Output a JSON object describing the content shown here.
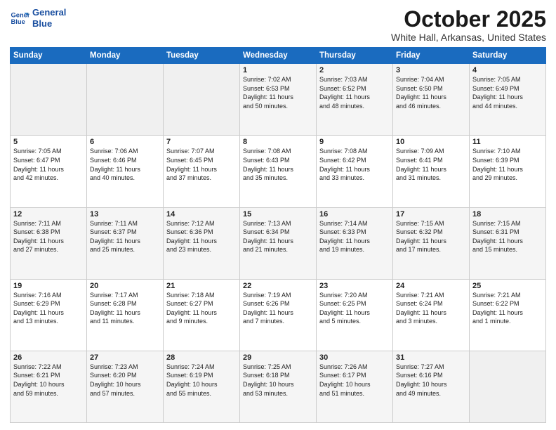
{
  "header": {
    "logo_line1": "General",
    "logo_line2": "Blue",
    "month": "October 2025",
    "location": "White Hall, Arkansas, United States"
  },
  "days_of_week": [
    "Sunday",
    "Monday",
    "Tuesday",
    "Wednesday",
    "Thursday",
    "Friday",
    "Saturday"
  ],
  "weeks": [
    [
      {
        "day": "",
        "info": ""
      },
      {
        "day": "",
        "info": ""
      },
      {
        "day": "",
        "info": ""
      },
      {
        "day": "1",
        "info": "Sunrise: 7:02 AM\nSunset: 6:53 PM\nDaylight: 11 hours\nand 50 minutes."
      },
      {
        "day": "2",
        "info": "Sunrise: 7:03 AM\nSunset: 6:52 PM\nDaylight: 11 hours\nand 48 minutes."
      },
      {
        "day": "3",
        "info": "Sunrise: 7:04 AM\nSunset: 6:50 PM\nDaylight: 11 hours\nand 46 minutes."
      },
      {
        "day": "4",
        "info": "Sunrise: 7:05 AM\nSunset: 6:49 PM\nDaylight: 11 hours\nand 44 minutes."
      }
    ],
    [
      {
        "day": "5",
        "info": "Sunrise: 7:05 AM\nSunset: 6:47 PM\nDaylight: 11 hours\nand 42 minutes."
      },
      {
        "day": "6",
        "info": "Sunrise: 7:06 AM\nSunset: 6:46 PM\nDaylight: 11 hours\nand 40 minutes."
      },
      {
        "day": "7",
        "info": "Sunrise: 7:07 AM\nSunset: 6:45 PM\nDaylight: 11 hours\nand 37 minutes."
      },
      {
        "day": "8",
        "info": "Sunrise: 7:08 AM\nSunset: 6:43 PM\nDaylight: 11 hours\nand 35 minutes."
      },
      {
        "day": "9",
        "info": "Sunrise: 7:08 AM\nSunset: 6:42 PM\nDaylight: 11 hours\nand 33 minutes."
      },
      {
        "day": "10",
        "info": "Sunrise: 7:09 AM\nSunset: 6:41 PM\nDaylight: 11 hours\nand 31 minutes."
      },
      {
        "day": "11",
        "info": "Sunrise: 7:10 AM\nSunset: 6:39 PM\nDaylight: 11 hours\nand 29 minutes."
      }
    ],
    [
      {
        "day": "12",
        "info": "Sunrise: 7:11 AM\nSunset: 6:38 PM\nDaylight: 11 hours\nand 27 minutes."
      },
      {
        "day": "13",
        "info": "Sunrise: 7:11 AM\nSunset: 6:37 PM\nDaylight: 11 hours\nand 25 minutes."
      },
      {
        "day": "14",
        "info": "Sunrise: 7:12 AM\nSunset: 6:36 PM\nDaylight: 11 hours\nand 23 minutes."
      },
      {
        "day": "15",
        "info": "Sunrise: 7:13 AM\nSunset: 6:34 PM\nDaylight: 11 hours\nand 21 minutes."
      },
      {
        "day": "16",
        "info": "Sunrise: 7:14 AM\nSunset: 6:33 PM\nDaylight: 11 hours\nand 19 minutes."
      },
      {
        "day": "17",
        "info": "Sunrise: 7:15 AM\nSunset: 6:32 PM\nDaylight: 11 hours\nand 17 minutes."
      },
      {
        "day": "18",
        "info": "Sunrise: 7:15 AM\nSunset: 6:31 PM\nDaylight: 11 hours\nand 15 minutes."
      }
    ],
    [
      {
        "day": "19",
        "info": "Sunrise: 7:16 AM\nSunset: 6:29 PM\nDaylight: 11 hours\nand 13 minutes."
      },
      {
        "day": "20",
        "info": "Sunrise: 7:17 AM\nSunset: 6:28 PM\nDaylight: 11 hours\nand 11 minutes."
      },
      {
        "day": "21",
        "info": "Sunrise: 7:18 AM\nSunset: 6:27 PM\nDaylight: 11 hours\nand 9 minutes."
      },
      {
        "day": "22",
        "info": "Sunrise: 7:19 AM\nSunset: 6:26 PM\nDaylight: 11 hours\nand 7 minutes."
      },
      {
        "day": "23",
        "info": "Sunrise: 7:20 AM\nSunset: 6:25 PM\nDaylight: 11 hours\nand 5 minutes."
      },
      {
        "day": "24",
        "info": "Sunrise: 7:21 AM\nSunset: 6:24 PM\nDaylight: 11 hours\nand 3 minutes."
      },
      {
        "day": "25",
        "info": "Sunrise: 7:21 AM\nSunset: 6:22 PM\nDaylight: 11 hours\nand 1 minute."
      }
    ],
    [
      {
        "day": "26",
        "info": "Sunrise: 7:22 AM\nSunset: 6:21 PM\nDaylight: 10 hours\nand 59 minutes."
      },
      {
        "day": "27",
        "info": "Sunrise: 7:23 AM\nSunset: 6:20 PM\nDaylight: 10 hours\nand 57 minutes."
      },
      {
        "day": "28",
        "info": "Sunrise: 7:24 AM\nSunset: 6:19 PM\nDaylight: 10 hours\nand 55 minutes."
      },
      {
        "day": "29",
        "info": "Sunrise: 7:25 AM\nSunset: 6:18 PM\nDaylight: 10 hours\nand 53 minutes."
      },
      {
        "day": "30",
        "info": "Sunrise: 7:26 AM\nSunset: 6:17 PM\nDaylight: 10 hours\nand 51 minutes."
      },
      {
        "day": "31",
        "info": "Sunrise: 7:27 AM\nSunset: 6:16 PM\nDaylight: 10 hours\nand 49 minutes."
      },
      {
        "day": "",
        "info": ""
      }
    ]
  ]
}
